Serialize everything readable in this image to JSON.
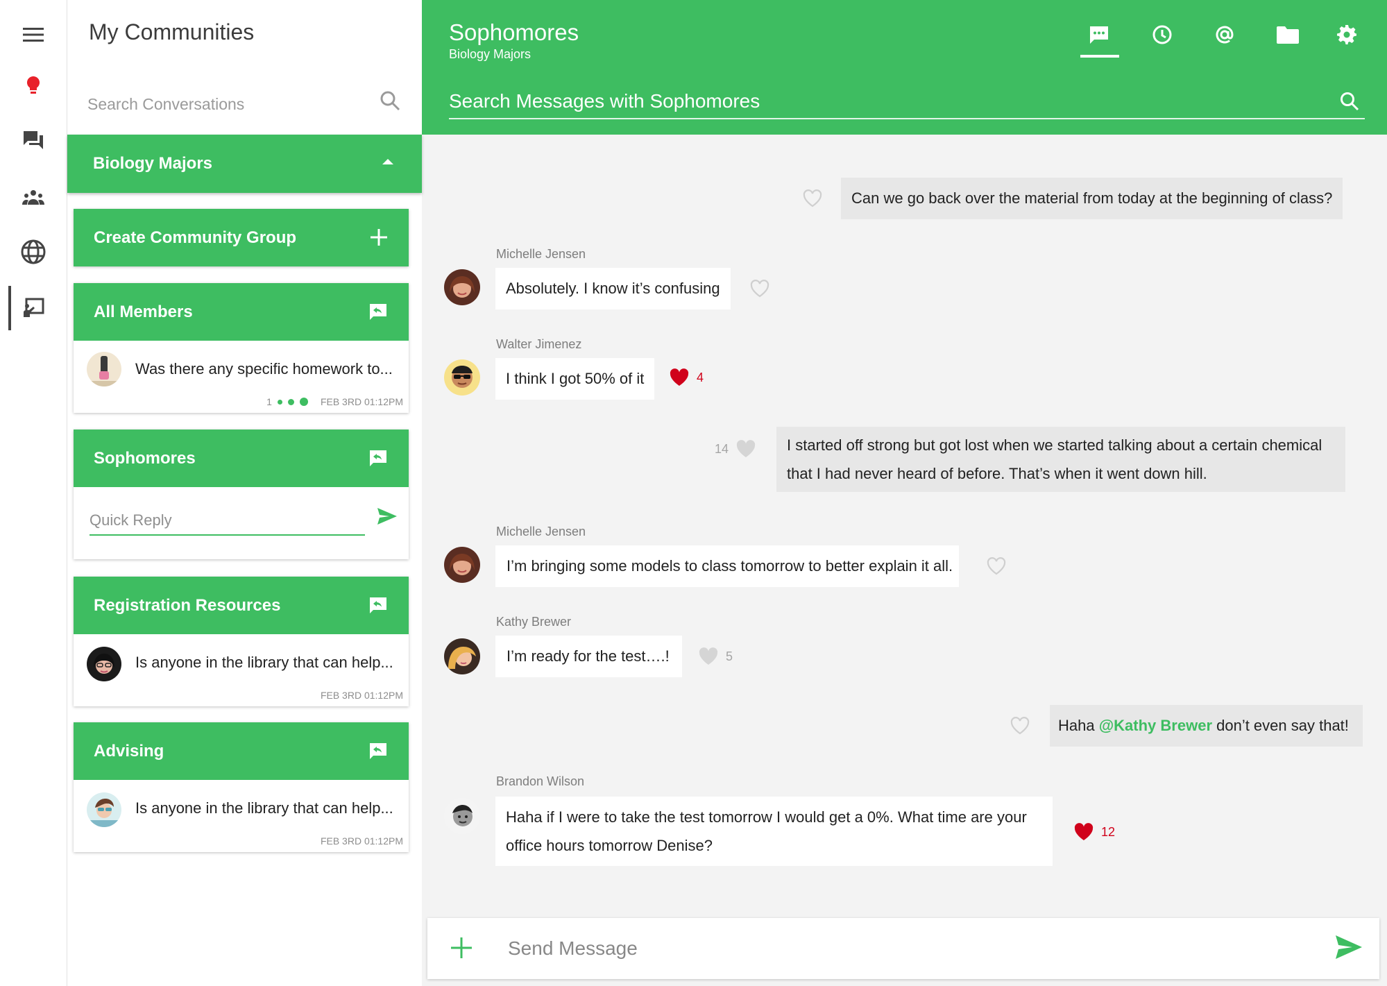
{
  "communities": {
    "title": "My Communities",
    "search_placeholder": "Search Conversations",
    "group_name": "Biology Majors",
    "create_group_label": "Create Community Group",
    "cards": [
      {
        "name": "All Members",
        "preview": "Was there any specific homework to...",
        "unread_count": "1",
        "time": "FEB 3RD 01:12PM"
      },
      {
        "name": "Sophomores",
        "quick_reply_placeholder": "Quick Reply"
      },
      {
        "name": "Registration Resources",
        "preview": "Is anyone in the library that can help...",
        "time": "FEB 3RD 01:12PM"
      },
      {
        "name": "Advising",
        "preview": "Is anyone in the library that can help...",
        "time": "FEB 3RD 01:12PM"
      }
    ]
  },
  "chat": {
    "title": "Sophomores",
    "subtitle": "Biology Majors",
    "search_placeholder": "Search Messages with Sophomores",
    "composer_placeholder": "Send Message",
    "accent_color": "#3ebd61",
    "like_color": "#d0021b",
    "messages": [
      {
        "direction": "out",
        "text": "Can we go back over the material from today at the beginning of class?"
      },
      {
        "direction": "in",
        "sender": "Michelle Jensen",
        "text": "Absolutely. I know it’s confusing"
      },
      {
        "direction": "in",
        "sender": "Walter Jimenez",
        "text": "I think I got 50% of it",
        "likes": "4"
      },
      {
        "direction": "out",
        "text_line1": "I started off strong but got lost when we started talking about a certain chemical",
        "text_line2": "that I had never heard of before. That’s when it went down hill.",
        "likes": "14"
      },
      {
        "direction": "in",
        "sender": "Michelle Jensen",
        "text": "I’m bringing some models to class tomorrow to better explain it all."
      },
      {
        "direction": "in",
        "sender": "Kathy Brewer",
        "text": "I’m ready for the test….!",
        "likes": "5"
      },
      {
        "direction": "out",
        "text_before": "Haha ",
        "mention": "@Kathy Brewer",
        "text_after": " don’t even say that!"
      },
      {
        "direction": "in",
        "sender": "Brandon Wilson",
        "text_line1": "Haha if I were to take the test tomorrow I would get a 0%. What time are your",
        "text_line2": "office hours tomorrow Denise?",
        "likes": "12"
      }
    ]
  }
}
